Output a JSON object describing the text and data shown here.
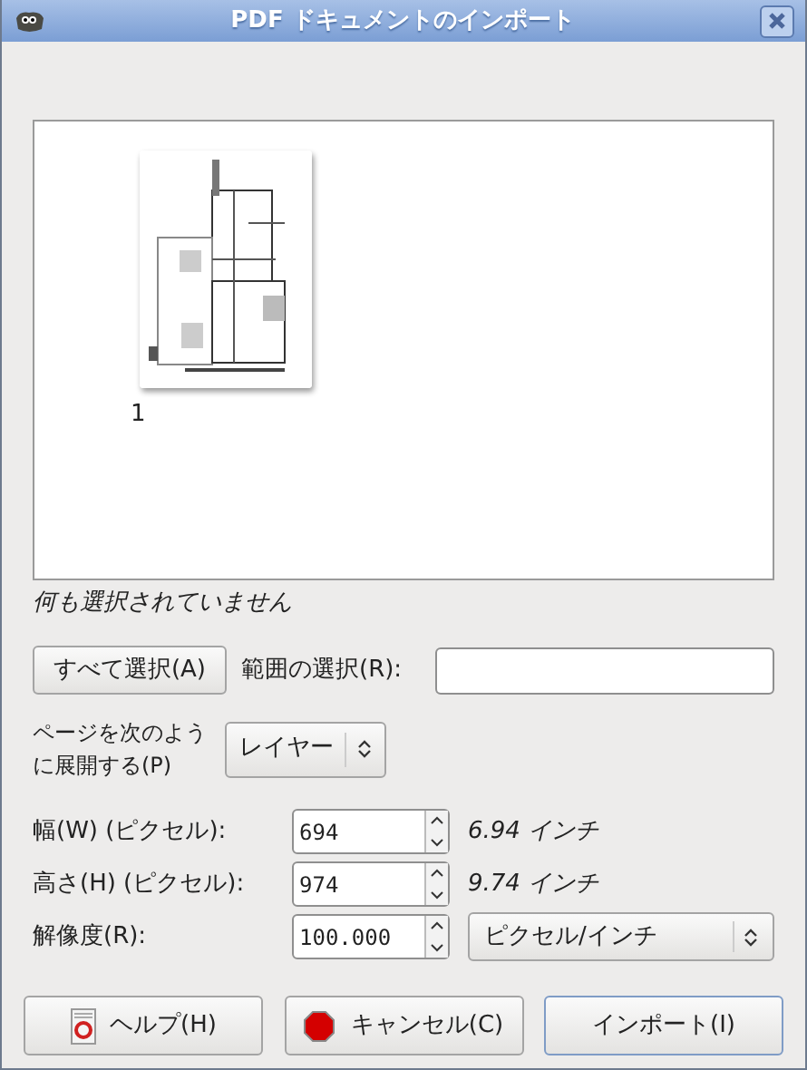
{
  "window": {
    "title": "PDF ドキュメントのインポート"
  },
  "pages": [
    {
      "label": "1",
      "selected": false
    }
  ],
  "selection_status": "何も選択されていません",
  "select_all_button": "すべて選択(A)",
  "range": {
    "label": "範囲の選択(R):"
  },
  "open_pages": {
    "label": "ページを次のように展開する(P)",
    "value": "レイヤー"
  },
  "fields": [
    {
      "label": "幅(W) (ピクセル):",
      "value": "694",
      "unit": "6.94 インチ"
    },
    {
      "label": "高さ(H) (ピクセル):",
      "value": "974",
      "unit": "9.74 インチ"
    },
    {
      "label": "解像度(R):",
      "value": "100.000",
      "unit_select": "ピクセル/インチ"
    }
  ],
  "buttons": [
    {
      "label": "ヘルプ(H)",
      "kind": "help",
      "default": false
    },
    {
      "label": "キャンセル(C)",
      "kind": "cancel",
      "default": false
    },
    {
      "label": "インポート(I)",
      "kind": "plain",
      "default": true
    }
  ]
}
